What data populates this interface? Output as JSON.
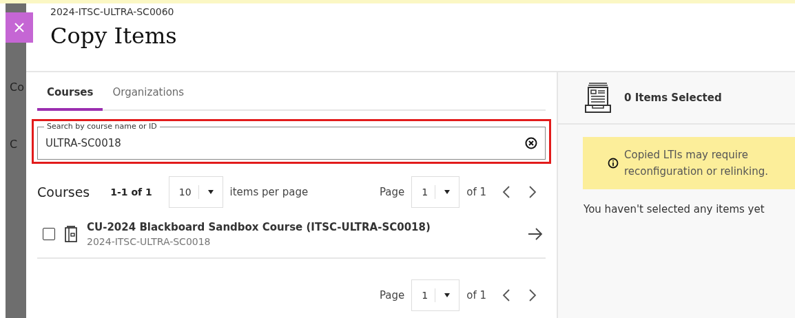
{
  "background": {
    "fragments": [
      "Co",
      "C"
    ]
  },
  "header": {
    "course_id": "2024-ITSC-ULTRA-SC0060",
    "title": "Copy Items"
  },
  "tabs": [
    {
      "label": "Courses",
      "selected": true
    },
    {
      "label": "Organizations",
      "selected": false
    }
  ],
  "search": {
    "label": "Search by course name or ID",
    "value": "ULTRA-SC0018",
    "highlighted": true
  },
  "list_header": {
    "title": "Courses",
    "range": "1-1 of 1",
    "per_page": "10",
    "per_page_label": "items per page"
  },
  "pagination": [
    {
      "label": "Page",
      "page": "1",
      "of": "of 1"
    },
    {
      "label": "Page",
      "page": "1",
      "of": "of 1"
    }
  ],
  "courses": [
    {
      "name": "CU-2024 Blackboard Sandbox Course (ITSC-ULTRA-SC0018)",
      "id": "2024-ITSC-ULTRA-SC0018",
      "checked": false
    }
  ],
  "selection": {
    "count": "0 Items Selected",
    "notice": "Copied LTIs may require reconfiguration or relinking.",
    "empty": "You haven't selected any items yet"
  }
}
